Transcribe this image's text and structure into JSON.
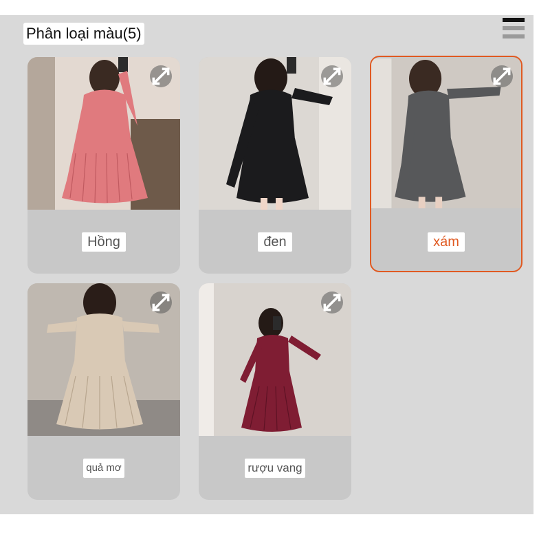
{
  "header": {
    "title": "Phân loại màu(5)"
  },
  "variants": [
    {
      "label": "Hồng",
      "selected": false,
      "color": "#e07a7e",
      "bg": "#e6ddd6"
    },
    {
      "label": "đen",
      "selected": false,
      "color": "#1b1b1d",
      "bg": "#dcd8d3"
    },
    {
      "label": "xám",
      "selected": true,
      "color": "#57585a",
      "bg": "#cfc9c3"
    },
    {
      "label": "quả mơ",
      "selected": false,
      "color": "#d9c9b5",
      "bg": "#bfb8b0"
    },
    {
      "label": "rượu vang",
      "selected": false,
      "color": "#7f1d33",
      "bg": "#d8d3ce"
    }
  ],
  "accent": "#e05a22"
}
